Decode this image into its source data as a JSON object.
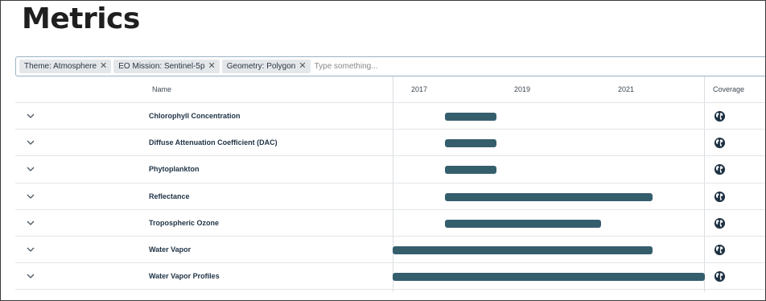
{
  "page": {
    "title": "Metrics"
  },
  "filters": {
    "chips": [
      {
        "label": "Theme: Atmosphere"
      },
      {
        "label": "EO Mission: Sentinel-5p"
      },
      {
        "label": "Geometry: Polygon"
      }
    ],
    "remove_glyph": "✕",
    "placeholder": "Type something..."
  },
  "table": {
    "headers": {
      "name": "Name",
      "coverage": "Coverage"
    },
    "timeline": {
      "years": [
        "2017",
        "2019",
        "2021"
      ],
      "domain_start": 2016.0,
      "domain_end": 2022.0
    },
    "rows": [
      {
        "name": "Chlorophyll Concentration",
        "start": 2017.0,
        "end": 2018.0
      },
      {
        "name": "Diffuse Attenuation Coefficient (DAC)",
        "start": 2017.0,
        "end": 2018.0
      },
      {
        "name": "Phytoplankton",
        "start": 2017.0,
        "end": 2018.0
      },
      {
        "name": "Reflectance",
        "start": 2017.0,
        "end": 2021.0
      },
      {
        "name": "Tropospheric Ozone",
        "start": 2017.0,
        "end": 2020.0
      },
      {
        "name": "Water Vapor",
        "start": 2016.0,
        "end": 2021.0
      },
      {
        "name": "Water Vapor Profiles",
        "start": 2016.0,
        "end": 2022.0
      }
    ],
    "icons": {
      "expand": "chevron-down-icon",
      "coverage": "globe-icon"
    },
    "colors": {
      "bar": "#355e6d",
      "globe": "#1e3244"
    }
  }
}
